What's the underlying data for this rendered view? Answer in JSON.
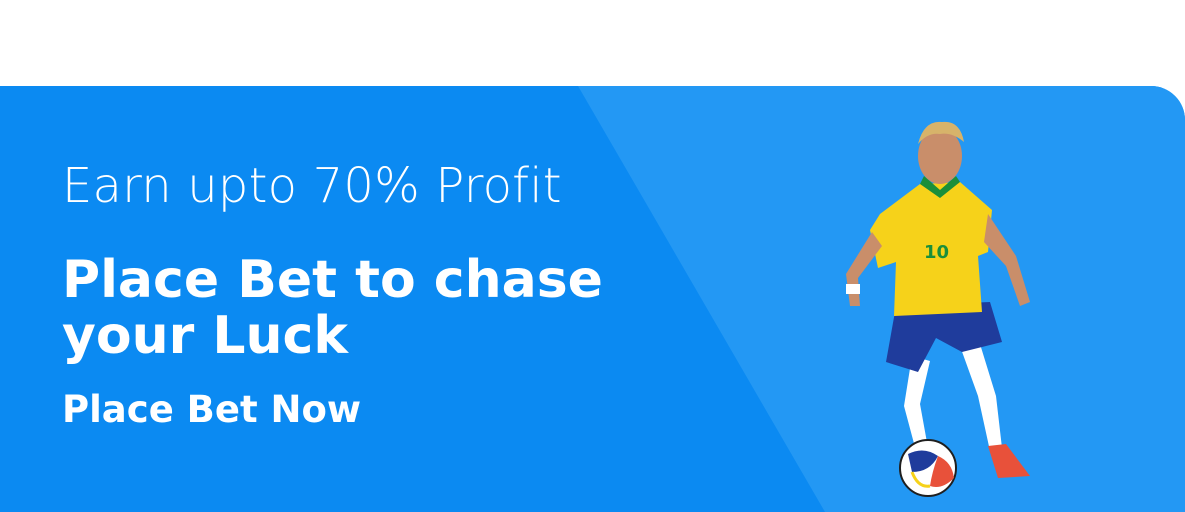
{
  "banner": {
    "headline": "Earn upto 70% Profit",
    "tagline": "Place Bet to chase your Luck",
    "cta_label": "Place Bet Now"
  },
  "colors": {
    "banner_primary": "#0b8af2",
    "banner_panel": "#2398f4",
    "text": "#ffffff",
    "jersey": "#f6d21a",
    "shorts": "#1f3c9c",
    "jersey_trim": "#1a8f3a"
  },
  "icons": {
    "player": "football-player-illustration",
    "ball": "soccer-ball-icon"
  }
}
